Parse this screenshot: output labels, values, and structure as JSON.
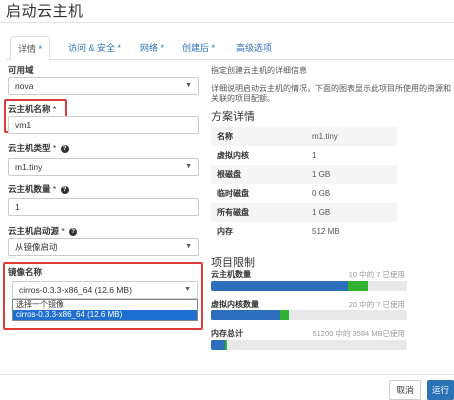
{
  "dialog": {
    "title": "启动云主机"
  },
  "tabs": [
    {
      "label": "详情",
      "suffix": " *"
    },
    {
      "label": "访问 & 安全",
      "suffix": " *"
    },
    {
      "label": "网络",
      "suffix": " *"
    },
    {
      "label": "创建后",
      "suffix": " *"
    },
    {
      "label": "高级选项",
      "suffix": ""
    }
  ],
  "form": {
    "availability_zone": {
      "label": "可用域",
      "value": "nova"
    },
    "instance_name": {
      "label": "云主机名称",
      "required": " *",
      "value": "vm1"
    },
    "flavor": {
      "label": "云主机类型",
      "required": " *",
      "value": "m1.tiny"
    },
    "count": {
      "label": "云主机数量",
      "required": " *",
      "value": "1"
    },
    "boot_source": {
      "label": "云主机启动源",
      "required": " *",
      "value": "从镜像启动"
    },
    "image_name": {
      "label": "镜像名称",
      "value": "cirros-0.3.3-x86_64 (12.6 MB)",
      "options": [
        "选择一个镜像",
        "cirros-0.3.3-x86_64 (12.6 MB)"
      ],
      "highlighted_option": "cirros-0.3.3-x86_64 (12.6 MB)"
    }
  },
  "right_panel": {
    "intro_title": "指定创建云主机的详细信息",
    "intro_text": "详细说明启动云主机的情况，下面的图表显示此项目所使用的资源和关联的项目配额。",
    "flavor_heading": "方案详情",
    "flavor_details": [
      {
        "name": "名称",
        "value": "m1.tiny"
      },
      {
        "name": "虚拟内核",
        "value": "1"
      },
      {
        "name": "根磁盘",
        "value": "1 GB"
      },
      {
        "name": "临时磁盘",
        "value": "0 GB"
      },
      {
        "name": "所有磁盘",
        "value": "1 GB"
      },
      {
        "name": "内存",
        "value": "512 MB"
      }
    ],
    "limits_heading": "项目限制",
    "limits": [
      {
        "label": "云主机数量",
        "info": "10 中的 7 已使用",
        "used_fraction": 0.7,
        "added_fraction": 0.1
      },
      {
        "label": "虚拟内核数量",
        "info": "20 中的 7 已使用",
        "used_fraction": 0.35,
        "added_fraction": 0.05
      },
      {
        "label": "内存总计",
        "info": "51200 中的 3584 MB已使用",
        "used_fraction": 0.07,
        "added_fraction": 0.01
      }
    ]
  },
  "footer": {
    "cancel_label": "取消",
    "launch_label": "运行"
  },
  "colors": {
    "accent": "#2a72b5",
    "used_bar": "#2e6fbd",
    "added_bar": "#31b331",
    "highlight_box": "#e03b3b"
  }
}
